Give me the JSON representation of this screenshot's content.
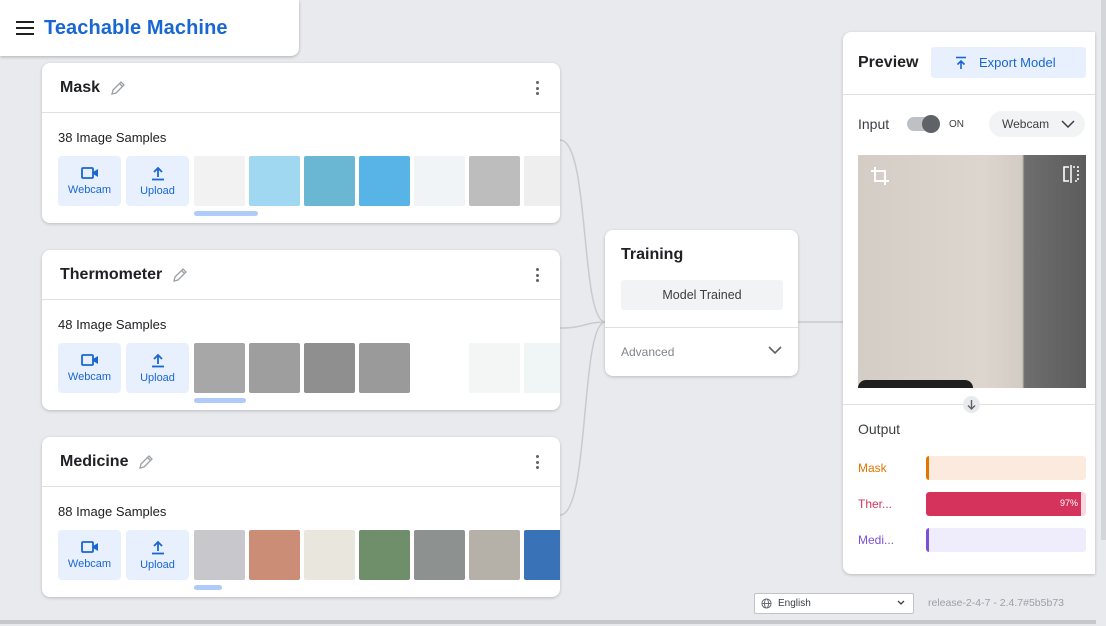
{
  "app": {
    "title": "Teachable Machine"
  },
  "classes": [
    {
      "name": "Mask",
      "samples": "38 Image Samples",
      "webcam_label": "Webcam",
      "upload_label": "Upload",
      "thumb_colors": [
        "#f2f2f2",
        "#9fd8f0",
        "#6ab7d3",
        "#58b3e6",
        "#f0f4f7",
        "#bdbdbd",
        "#eeeeee"
      ]
    },
    {
      "name": "Thermometer",
      "samples": "48 Image Samples",
      "webcam_label": "Webcam",
      "upload_label": "Upload",
      "thumb_colors": [
        "#a7a7a7",
        "#9e9e9e",
        "#8f8f8f",
        "#9a9a9a",
        "#ffffff",
        "#f4f6f6",
        "#f0f5f5"
      ]
    },
    {
      "name": "Medicine",
      "samples": "88 Image Samples",
      "webcam_label": "Webcam",
      "upload_label": "Upload",
      "thumb_colors": [
        "#c7c7cc",
        "#cc8d76",
        "#e9e6dd",
        "#6f8f6a",
        "#8d9291",
        "#b5b1a8",
        "#3a72b8"
      ]
    }
  ],
  "training": {
    "title": "Training",
    "status_button": "Model Trained",
    "advanced_label": "Advanced"
  },
  "preview": {
    "title": "Preview",
    "export_label": "Export Model",
    "input_label": "Input",
    "toggle_state": "ON",
    "source_select": "Webcam",
    "output_label": "Output",
    "outputs": [
      {
        "label": "Mask",
        "percent": 1,
        "pct_text": "",
        "color": "#e37400",
        "track": "#fdeadf"
      },
      {
        "label": "Ther...",
        "percent": 97,
        "pct_text": "97%",
        "color": "#d6335c",
        "track": "#f9d9e1"
      },
      {
        "label": "Medi...",
        "percent": 2,
        "pct_text": "",
        "color": "#7b4fd9",
        "track": "#efecfc"
      }
    ]
  },
  "footer": {
    "language": "English",
    "release": "release-2-4-7 - 2.4.7#5b5b73"
  },
  "icons": {
    "menu": "menu-icon",
    "edit": "pencil-icon",
    "more": "kebab-icon",
    "webcam": "video-camera-icon",
    "upload": "upload-icon",
    "export": "upload-arrow-icon",
    "crop": "crop-icon",
    "flip": "flip-icon",
    "down": "arrow-down-icon",
    "language": "globe-icon"
  }
}
